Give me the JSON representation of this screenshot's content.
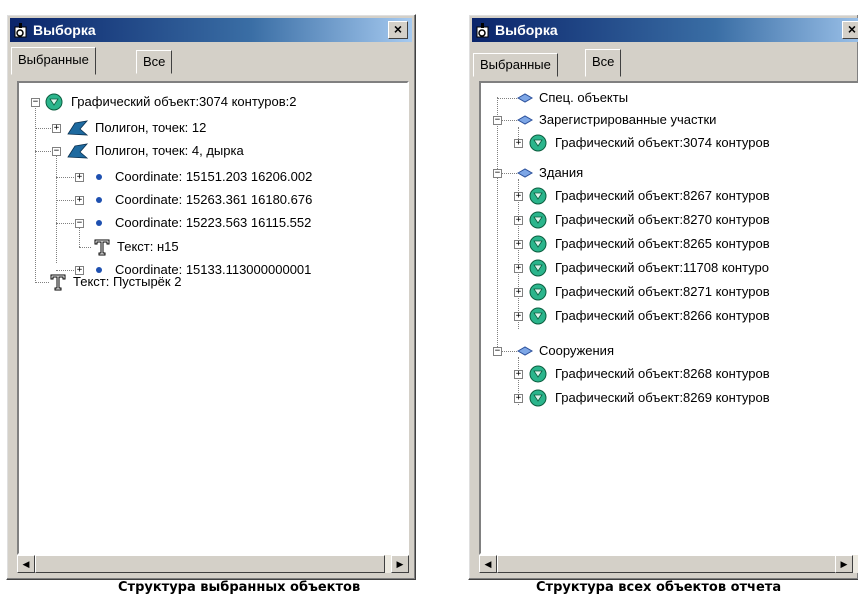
{
  "left_window": {
    "title": "Выборка",
    "close": "×",
    "tabs": [
      "Выбранные",
      "Все"
    ],
    "active_tab": 0,
    "tree": [
      {
        "label": "Графический объект:3074 контуров:2",
        "icon": "graphic-object-icon",
        "expander": "−"
      },
      {
        "label": "Полигон, точек: 12",
        "icon": "polygon-icon",
        "expander": "+"
      },
      {
        "label": "Полигон, точек: 4, дырка",
        "icon": "polygon-icon",
        "expander": "−"
      },
      {
        "label": "Coordinate: 15151.203 16206.002",
        "icon": "point-icon",
        "expander": "+"
      },
      {
        "label": "Coordinate: 15263.361 16180.676",
        "icon": "point-icon",
        "expander": "+"
      },
      {
        "label": "Coordinate: 15223.563 16115.552",
        "icon": "point-icon",
        "expander": "−"
      },
      {
        "label": "Текст: н15",
        "icon": "text-icon",
        "expander": ""
      },
      {
        "label": "Coordinate: 15133.113000000001",
        "icon": "point-icon",
        "expander": "+"
      },
      {
        "label": "Текст: Пустырёк 2",
        "icon": "text-icon",
        "expander": ""
      }
    ],
    "caption": "Структура выбранных объектов"
  },
  "right_window": {
    "title": "Выборка",
    "close": "×",
    "tabs": [
      "Выбранные",
      "Все"
    ],
    "active_tab": 1,
    "tree": [
      {
        "label": "Спец. объекты",
        "icon": "layer-icon",
        "expander": ""
      },
      {
        "label": "Зарегистрированные участки",
        "icon": "layer-icon",
        "expander": "−"
      },
      {
        "label": "Графический объект:3074 контуров",
        "icon": "graphic-object-icon",
        "expander": "+"
      },
      {
        "label": "Здания",
        "icon": "layer-icon",
        "expander": "−"
      },
      {
        "label": "Графический объект:8267 контуров",
        "icon": "graphic-object-icon",
        "expander": "+"
      },
      {
        "label": "Графический объект:8270 контуров",
        "icon": "graphic-object-icon",
        "expander": "+"
      },
      {
        "label": "Графический объект:8265 контуров",
        "icon": "graphic-object-icon",
        "expander": "+"
      },
      {
        "label": "Графический объект:11708 контуро",
        "icon": "graphic-object-icon",
        "expander": "+"
      },
      {
        "label": "Графический объект:8271 контуров",
        "icon": "graphic-object-icon",
        "expander": "+"
      },
      {
        "label": "Графический объект:8266 контуров",
        "icon": "graphic-object-icon",
        "expander": "+"
      },
      {
        "label": "Сооружения",
        "icon": "layer-icon",
        "expander": "−"
      },
      {
        "label": "Графический объект:8268 контуров",
        "icon": "graphic-object-icon",
        "expander": "+"
      },
      {
        "label": "Графический объект:8269 контуров",
        "icon": "graphic-object-icon",
        "expander": "+"
      }
    ],
    "caption": "Структура всех объектов отчета"
  },
  "colors": {
    "titlebar_start": "#0a246a",
    "titlebar_end": "#a6caf0",
    "graphic_object_teal": "#2bb58c",
    "polygon_blue": "#1e6aa0",
    "layer_blue": "#7da6e6"
  }
}
